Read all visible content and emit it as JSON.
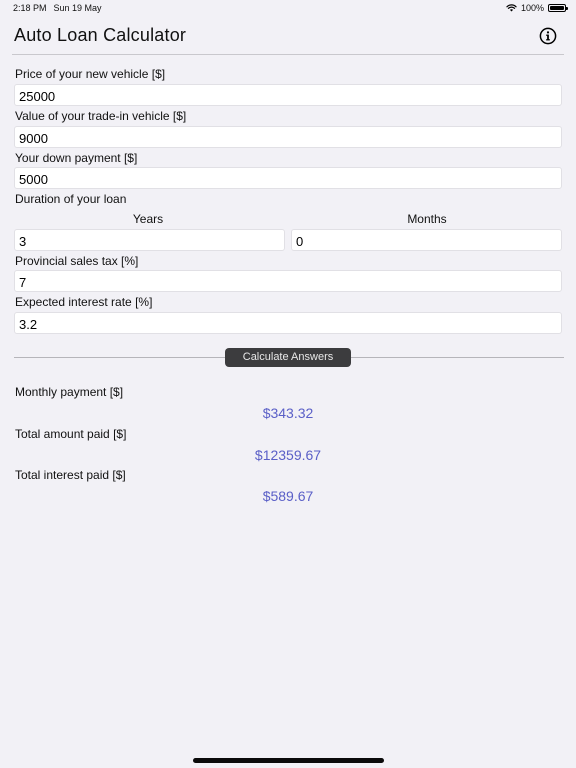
{
  "status_bar": {
    "time": "2:18 PM",
    "date": "Sun 19 May",
    "battery_percent": "100%",
    "battery_level": 1.0,
    "icons": [
      "wifi-icon",
      "battery-icon"
    ]
  },
  "nav": {
    "title": "Auto Loan Calculator",
    "info_icon": "info-circle-icon"
  },
  "form": {
    "price": {
      "label": "Price of your new vehicle [$]",
      "value": "25000"
    },
    "trade_in": {
      "label": "Value of your trade-in vehicle [$]",
      "value": "9000"
    },
    "down_payment": {
      "label": "Your down payment [$]",
      "value": "5000"
    },
    "duration": {
      "label": "Duration of your loan",
      "years_label": "Years",
      "months_label": "Months",
      "years_value": "3",
      "months_value": "0"
    },
    "sales_tax": {
      "label": "Provincial sales tax [%]",
      "value": "7"
    },
    "interest_rate": {
      "label": "Expected interest rate [%]",
      "value": "3.2"
    }
  },
  "actions": {
    "calculate_label": "Calculate Answers"
  },
  "results": {
    "monthly_payment": {
      "label": "Monthly payment [$]",
      "value": "$343.32"
    },
    "total_amount": {
      "label": "Total amount paid [$]",
      "value": "$12359.67"
    },
    "total_interest": {
      "label": "Total interest paid [$]",
      "value": "$589.67"
    }
  },
  "colors": {
    "background": "#f2f1f6",
    "result_accent": "#5a5fc7",
    "button_bg": "#3c3c3e"
  }
}
